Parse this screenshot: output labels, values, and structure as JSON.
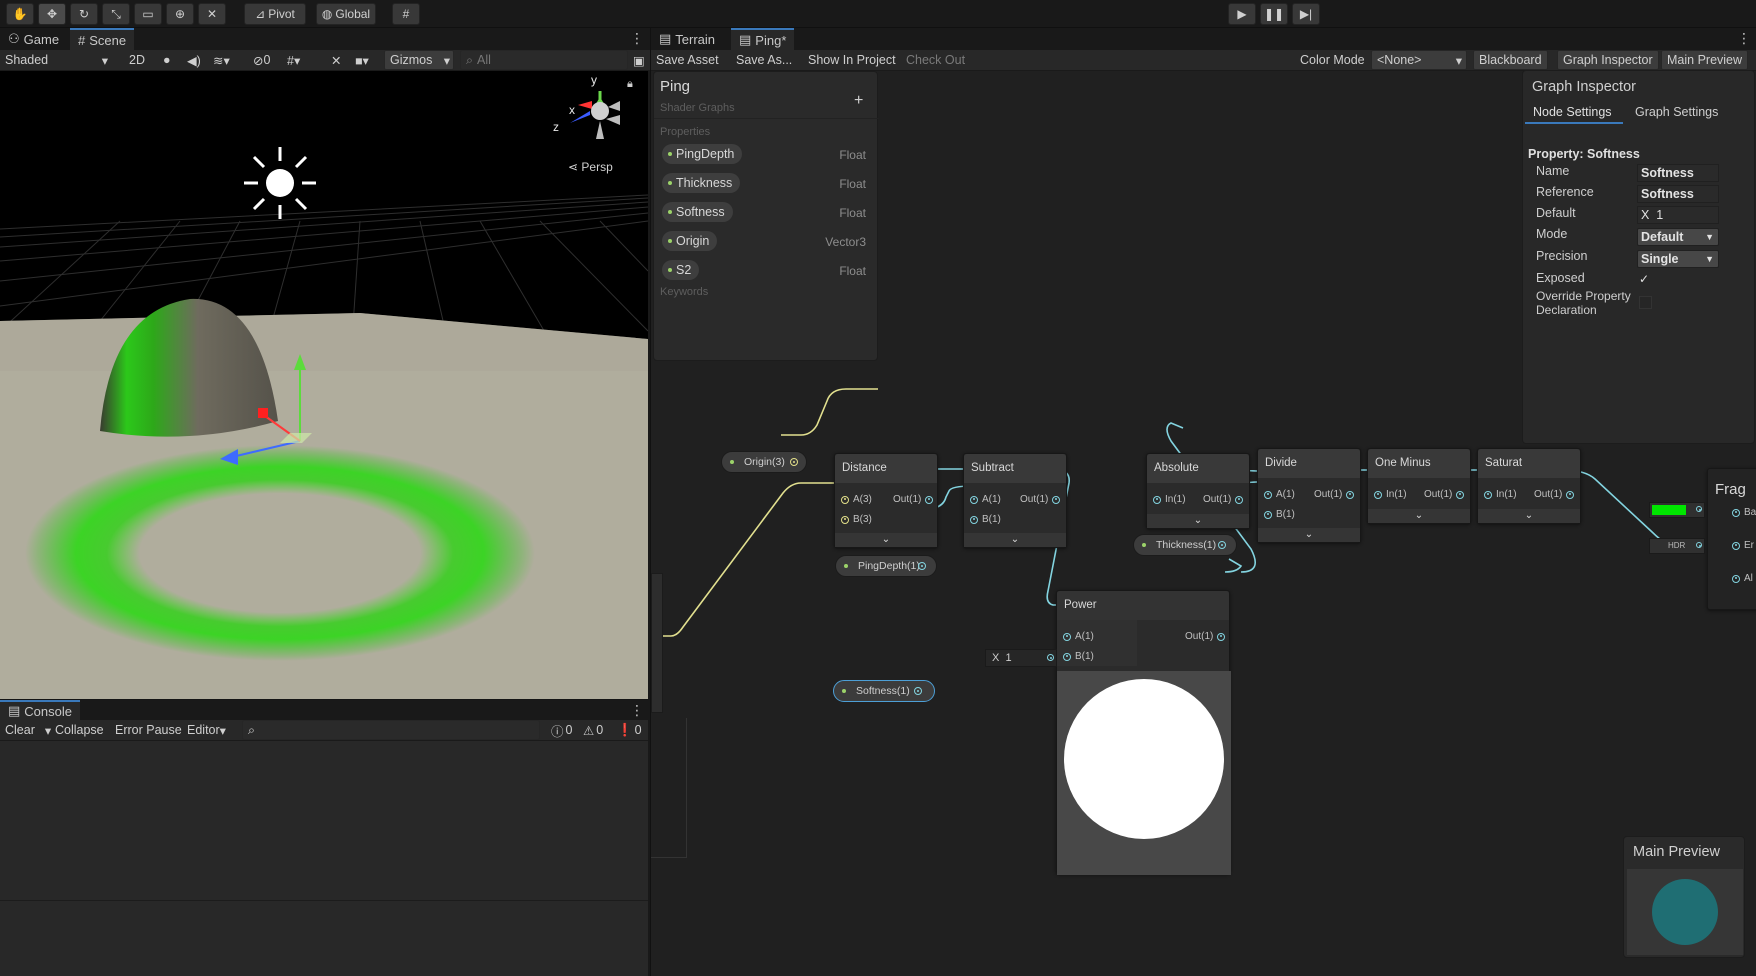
{
  "toolbar": {
    "pivot_label": "Pivot",
    "global_label": "Global",
    "colors": {
      "accent": "#3a79bb",
      "bg": "#191919"
    }
  },
  "scene_panel": {
    "tabs": [
      {
        "label": "Game"
      },
      {
        "label": "Scene"
      }
    ],
    "shading_mode": "Shaded",
    "mode_2d": "2D",
    "hidden_count": "0",
    "gizmos_label": "Gizmos",
    "search_placeholder": "All",
    "axis_y": "y",
    "axis_x": "x",
    "axis_z": "z",
    "persp_label": "Persp"
  },
  "console_panel": {
    "title": "Console",
    "clear_label": "Clear",
    "collapse_label": "Collapse",
    "error_pause_label": "Error Pause",
    "editor_label": "Editor",
    "log_count": "0",
    "warn_count": "0",
    "error_count": "0"
  },
  "graph_window": {
    "tabs": [
      {
        "label": "Terrain"
      },
      {
        "label": "Ping*"
      }
    ],
    "save_asset_label": "Save Asset",
    "save_as_label": "Save As...",
    "show_in_project_label": "Show In Project",
    "check_out_label": "Check Out",
    "color_mode_label": "Color Mode",
    "color_mode_value": "<None>",
    "blackboard_label": "Blackboard",
    "graph_inspector_label": "Graph Inspector",
    "main_preview_label": "Main Preview"
  },
  "blackboard": {
    "title": "Ping",
    "subtitle": "Shader Graphs",
    "add_glyph": "+",
    "properties_header": "Properties",
    "keywords_header": "Keywords",
    "properties": [
      {
        "name": "PingDepth",
        "type": "Float"
      },
      {
        "name": "Thickness",
        "type": "Float"
      },
      {
        "name": "Softness",
        "type": "Float"
      },
      {
        "name": "Origin",
        "type": "Vector3"
      },
      {
        "name": "S2",
        "type": "Float"
      }
    ]
  },
  "graph_inspector": {
    "title": "Graph Inspector",
    "tab_node_settings": "Node Settings",
    "tab_graph_settings": "Graph Settings",
    "property_title": "Property: Softness",
    "fields": {
      "name_label": "Name",
      "name_value": "Softness",
      "reference_label": "Reference",
      "reference_value": "Softness",
      "default_label": "Default",
      "default_axis": "X",
      "default_value": "1",
      "mode_label": "Mode",
      "mode_value": "Default",
      "precision_label": "Precision",
      "precision_value": "Single",
      "exposed_label": "Exposed",
      "exposed_checked": true,
      "override_label_1": "Override Property",
      "override_label_2": "Declaration",
      "override_checked": false
    }
  },
  "nodes": {
    "origin_prop": "Origin(3)",
    "pingdepth_prop": "PingDepth(1)",
    "softness_prop": "Softness(1)",
    "thickness_prop": "Thickness(1)",
    "distance": {
      "title": "Distance",
      "in_a": "A(3)",
      "in_b": "B(3)",
      "out": "Out(1)"
    },
    "subtract": {
      "title": "Subtract",
      "in_a": "A(1)",
      "in_b": "B(1)",
      "out": "Out(1)"
    },
    "absolute": {
      "title": "Absolute",
      "in": "In(1)",
      "out": "Out(1)"
    },
    "divide": {
      "title": "Divide",
      "in_a": "A(1)",
      "in_b": "B(1)",
      "out": "Out(1)"
    },
    "one_minus": {
      "title": "One Minus",
      "in": "In(1)",
      "out": "Out(1)"
    },
    "saturate": {
      "title": "Saturat",
      "in": "In(1)",
      "out": "Out(1)"
    },
    "power": {
      "title": "Power",
      "in_a": "A(1)",
      "in_b": "B(1)",
      "out": "Out(1)",
      "b_axis": "X",
      "b_value": "1"
    },
    "fragment": {
      "title": "Frag",
      "hdr_label": "HDR",
      "port_b": "Ba",
      "port_e": "Er",
      "port_a": "Al",
      "base_color": "#00e600"
    }
  },
  "main_preview": {
    "title": "Main Preview",
    "sphere_color": "#1e6e72"
  },
  "icons": [
    "hand-icon",
    "move-icon",
    "rotate-icon",
    "scale-icon",
    "rect-icon",
    "transform-icon",
    "custom-tool-icon",
    "grid-snap-icon",
    "play-icon",
    "pause-icon",
    "step-icon"
  ]
}
